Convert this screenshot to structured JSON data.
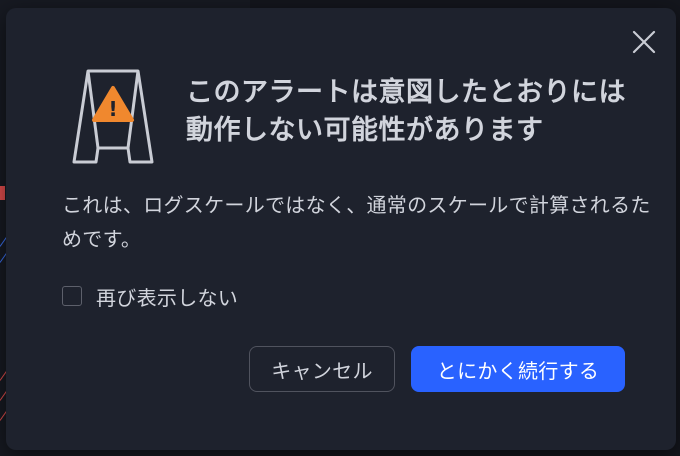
{
  "dialog": {
    "title": "このアラートは意図したとおりには動作しない可能性があります",
    "message": "これは、ログスケールではなく、通常のスケールで計算されるためです。",
    "checkbox_label": "再び表示しない",
    "checkbox_checked": false,
    "cancel_label": "キャンセル",
    "continue_label": "とにかく続行する",
    "warning_icon_glyph": "!"
  },
  "icons": {
    "close": "close-icon",
    "warning": "warning-sign-icon"
  },
  "colors": {
    "dialog_bg": "#1e222d",
    "text": "#d1d4dc",
    "primary_button": "#2962ff",
    "warning_orange": "#f0882e",
    "sign_outline": "#c9ccd4"
  }
}
